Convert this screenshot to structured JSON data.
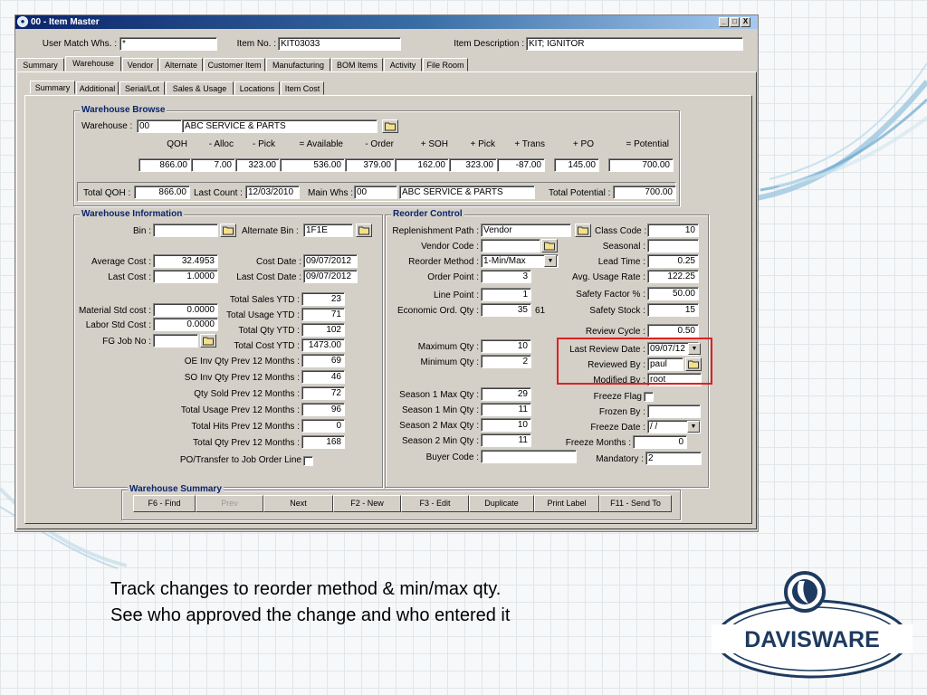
{
  "window": {
    "title": "00 - Item Master",
    "minimize": "_",
    "maximize": "□",
    "close": "X"
  },
  "header": {
    "user_match_label": "User Match Whs. :",
    "user_match_value": "*",
    "item_no_label": "Item No. :",
    "item_no_value": "KIT03033",
    "desc_label": "Item Description :",
    "desc_value": "KIT; IGNITOR"
  },
  "main_tabs": [
    "Summary",
    "Warehouse",
    "Vendor",
    "Alternate",
    "Customer Item",
    "Manufacturing",
    "BOM Items",
    "Activity",
    "File Room"
  ],
  "sub_tabs": [
    "Summary",
    "Additional",
    "Serial/Lot",
    "Sales & Usage",
    "Locations",
    "Item Cost"
  ],
  "wb": {
    "title": "Warehouse  Browse",
    "warehouse_label": "Warehouse :",
    "warehouse_code": "00",
    "warehouse_name": "ABC SERVICE & PARTS",
    "cols": [
      "QOH",
      "- Alloc",
      "- Pick",
      "= Available",
      "- Order",
      "+ SOH",
      "+ Pick",
      "+ Trans",
      "+ PO",
      "= Potential"
    ],
    "vals": [
      "866.00",
      "7.00",
      "323.00",
      "536.00",
      "379.00",
      "162.00",
      "323.00",
      "-87.00",
      "145.00",
      "700.00"
    ],
    "total_qoh_label": "Total QOH :",
    "total_qoh": "866.00",
    "last_count_label": "Last Count :",
    "last_count": "12/03/2010",
    "main_whs_label": "Main Whs :",
    "main_whs": "00",
    "main_whs_name": "ABC SERVICE & PARTS",
    "total_potential_label": "Total Potential :",
    "total_potential": "700.00"
  },
  "wi": {
    "title": "Warehouse Information",
    "bin_label": "Bin :",
    "bin": "",
    "alt_bin_label": "Alternate Bin :",
    "alt_bin": "1F1E",
    "avg_cost_label": "Average Cost :",
    "avg_cost": "32.4953",
    "cost_date_label": "Cost Date :",
    "cost_date": "09/07/2012",
    "last_cost_label": "Last Cost :",
    "last_cost": "1.0000",
    "last_cost_date_label": "Last Cost Date :",
    "last_cost_date": "09/07/2012",
    "mat_std_label": "Material Std cost :",
    "mat_std": "0.0000",
    "labor_std_label": "Labor Std Cost :",
    "labor_std": "0.0000",
    "fg_job_label": "FG Job No :",
    "fg_job": "",
    "stats": [
      {
        "label": "Total Sales YTD :",
        "value": "23"
      },
      {
        "label": "Total Usage YTD :",
        "value": "71"
      },
      {
        "label": "Total Qty YTD :",
        "value": "102"
      },
      {
        "label": "Total Cost YTD :",
        "value": "1473.00"
      },
      {
        "label": "OE Inv Qty Prev 12 Months :",
        "value": "69"
      },
      {
        "label": "SO Inv Qty Prev 12 Months :",
        "value": "46"
      },
      {
        "label": "Qty Sold Prev 12 Months :",
        "value": "72"
      },
      {
        "label": "Total Usage Prev 12 Months :",
        "value": "96"
      },
      {
        "label": "Total Hits Prev 12 Months :",
        "value": "0"
      },
      {
        "label": "Total Qty Prev 12 Months :",
        "value": "168"
      }
    ],
    "po_transfer_label": "PO/Transfer to Job Order Line"
  },
  "rc": {
    "title": "Reorder Control",
    "repl_path_label": "Replenishment Path :",
    "repl_path": "Vendor",
    "vendor_code_label": "Vendor Code :",
    "vendor_code": "",
    "reorder_method_label": "Reorder Method :",
    "reorder_method": "1-Min/Max",
    "order_point_label": "Order Point :",
    "order_point": "3",
    "line_point_label": "Line Point :",
    "line_point": "1",
    "eoq_label": "Economic Ord. Qty :",
    "eoq": "35",
    "eoq_extra": "61",
    "max_qty_label": "Maximum Qty :",
    "max_qty": "10",
    "min_qty_label": "Minimum  Qty :",
    "min_qty": "2",
    "s1max_label": "Season 1 Max Qty :",
    "s1max": "29",
    "s1min_label": "Season 1 Min  Qty :",
    "s1min": "11",
    "s2max_label": "Season 2 Max Qty :",
    "s2max": "10",
    "s2min_label": "Season 2 Min  Qty :",
    "s2min": "11",
    "buyer_label": "Buyer Code :",
    "buyer": "",
    "class_code_label": "Class Code :",
    "class_code": "10",
    "seasonal_label": "Seasonal :",
    "seasonal": "",
    "lead_time_label": "Lead Time :",
    "lead_time": "0.25",
    "avg_usage_label": "Avg. Usage Rate :",
    "avg_usage": "122.25",
    "safety_factor_label": "Safety Factor % :",
    "safety_factor": "50.00",
    "safety_stock_label": "Safety Stock :",
    "safety_stock": "15",
    "review_cycle_label": "Review Cycle :",
    "review_cycle": "0.50",
    "last_review_label": "Last Review Date :",
    "last_review": "09/07/12",
    "reviewed_by_label": "Reviewed By :",
    "reviewed_by": "paul",
    "modified_by_label": "Modified By :",
    "modified_by": "root",
    "freeze_flag_label": "Freeze Flag",
    "frozen_by_label": "Frozen By :",
    "frozen_by": "",
    "freeze_date_label": "Freeze Date :",
    "freeze_date": "/ /",
    "freeze_months_label": "Freeze Months :",
    "freeze_months": "0",
    "mandatory_label": "Mandatory :",
    "mandatory": "2",
    "highlight_color": "#e02020"
  },
  "ws": {
    "title": "Warehouse Summary",
    "buttons": [
      "F6 - Find",
      "Prev",
      "Next",
      "F2 - New",
      "F3 - Edit",
      "Duplicate",
      "Print Label",
      "F11 - Send To"
    ]
  },
  "caption": "Track changes to reorder method & min/max qty.  See who approved the change and who entered it",
  "logo": {
    "text": "DAVISWARE",
    "color": "#1e3a5f"
  }
}
